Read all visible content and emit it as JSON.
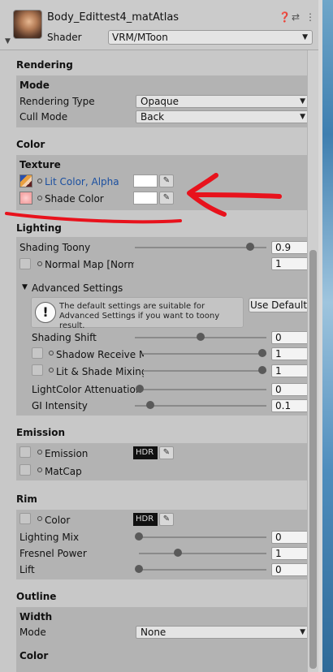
{
  "header": {
    "material_name": "Body_Edittest4_matAtlas",
    "shader_label": "Shader",
    "shader_value": "VRM/MToon",
    "icons": [
      "help-icon",
      "settings-sliders-icon",
      "kebab-menu-icon"
    ]
  },
  "rendering": {
    "section": "Rendering",
    "mode_heading": "Mode",
    "rendering_type_label": "Rendering Type",
    "rendering_type_value": "Opaque",
    "cull_mode_label": "Cull Mode",
    "cull_mode_value": "Back"
  },
  "color": {
    "section": "Color",
    "texture_heading": "Texture",
    "lit_color_label": "Lit Color, Alpha",
    "shade_color_label": "Shade Color"
  },
  "lighting": {
    "section": "Lighting",
    "shading_toony_label": "Shading Toony",
    "shading_toony_value": "0.9",
    "normal_map_label": "Normal Map [Norma",
    "normal_map_value": "1",
    "advanced_label": "Advanced Settings",
    "help_text": "The default settings are suitable for Advanced Settings if you want to toony result.",
    "use_default_label": "Use Default",
    "shading_shift_label": "Shading Shift",
    "shading_shift_value": "0",
    "shadow_receive_label": "Shadow Receive M",
    "shadow_receive_value": "1",
    "lit_shade_mixing_label": "Lit & Shade Mixing I",
    "lit_shade_mixing_value": "1",
    "lightcolor_attenuation_label": "LightColor Attenuation",
    "lightcolor_attenuation_value": "0",
    "gi_intensity_label": "GI Intensity",
    "gi_intensity_value": "0.1"
  },
  "emission": {
    "section": "Emission",
    "emission_label": "Emission",
    "hdr_label": "HDR",
    "matcap_label": "MatCap"
  },
  "rim": {
    "section": "Rim",
    "color_label": "Color",
    "hdr_label": "HDR",
    "lighting_mix_label": "Lighting Mix",
    "lighting_mix_value": "0",
    "fresnel_power_label": "Fresnel Power",
    "fresnel_power_value": "1",
    "lift_label": "Lift",
    "lift_value": "0"
  },
  "outline": {
    "section": "Outline",
    "width_heading": "Width",
    "mode_label": "Mode",
    "mode_value": "None",
    "color_heading": "Color"
  },
  "colors": {
    "link_blue": "#1a4fa0",
    "annotation_red": "#e8121c",
    "panel_bg": "#c8c8c8",
    "group_bg": "#b3b3b3"
  },
  "sliders": {
    "shading_toony": 0.9,
    "shading_shift": 0.5,
    "shadow_receive": 1.0,
    "lit_shade_mixing": 1.0,
    "lightcolor_attenuation": 0.0,
    "gi_intensity": 0.1,
    "lighting_mix": 0.0,
    "fresnel_power": 0.3,
    "lift": 0.0
  }
}
